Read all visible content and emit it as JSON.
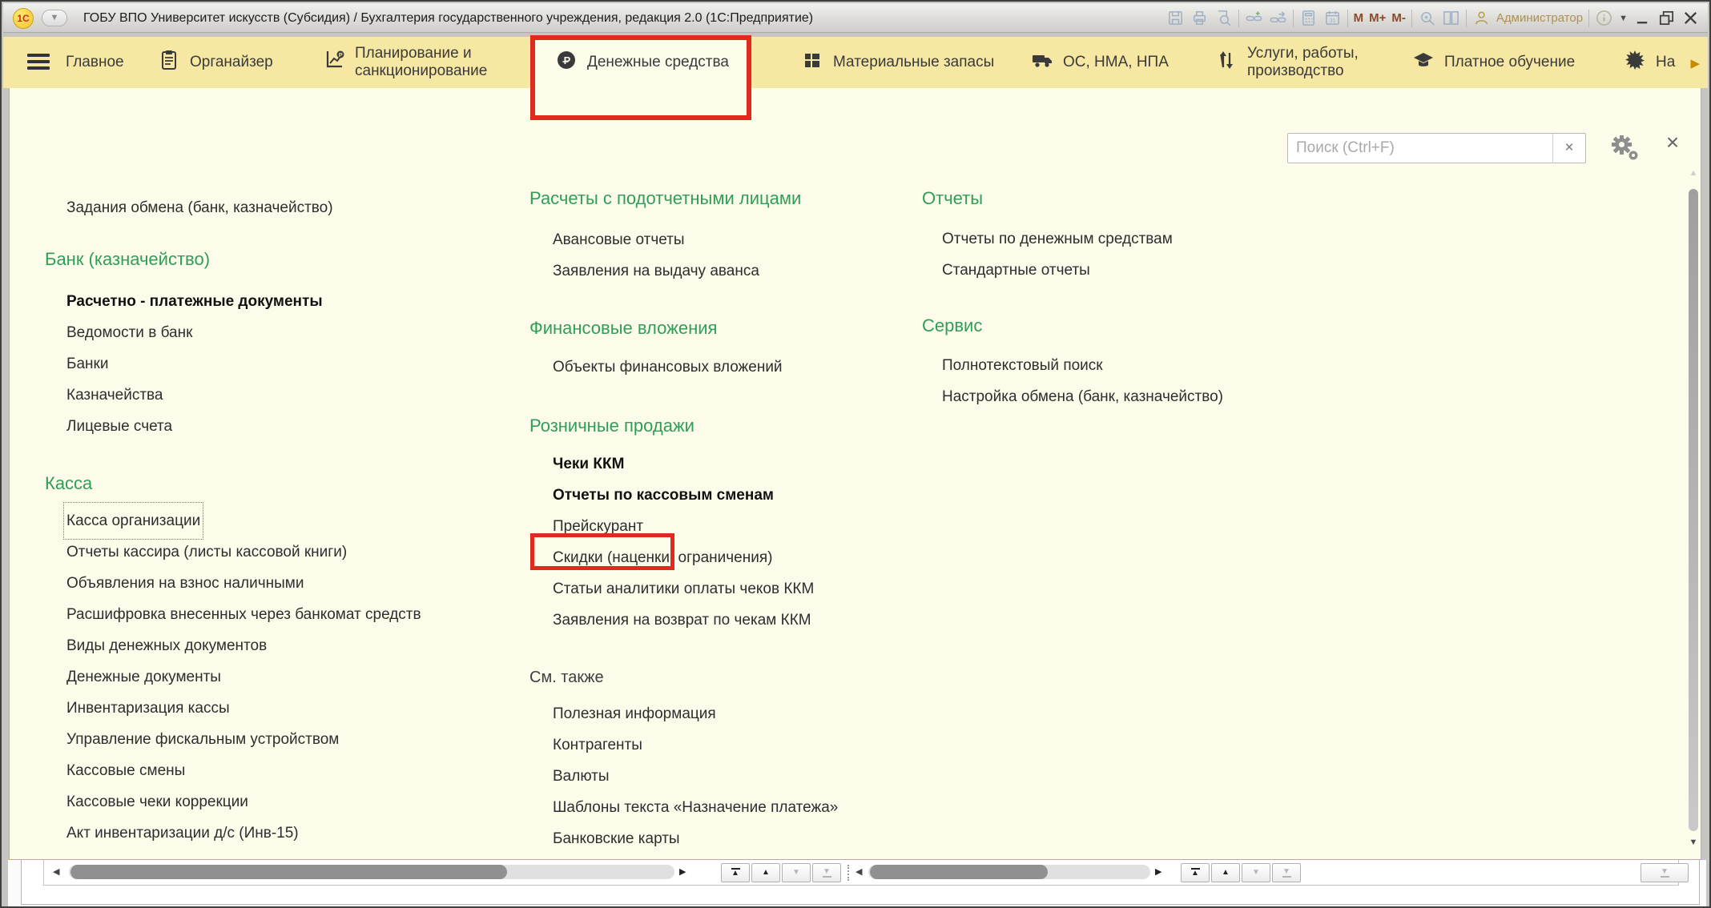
{
  "colors": {
    "accent_green": "#2f9e57",
    "tab_yellow": "#f6e7a3",
    "panel_bg": "#fdfceb",
    "annotation_red": "#e02a1e"
  },
  "titlebar": {
    "title": "ГОБУ ВПО Университет искусств (Субсидия) / Бухгалтерия государственного учреждения, редакция 2.0  (1С:Предприятие)",
    "memory": [
      "М",
      "М+",
      "М-"
    ],
    "user": "Администратор"
  },
  "tabs": [
    {
      "label": "Главное"
    },
    {
      "label": "Органайзер"
    },
    {
      "label": "Планирование и\nсанкционирование"
    },
    {
      "label": "Денежные средства",
      "active": true
    },
    {
      "label": "Материальные запасы"
    },
    {
      "label": "ОС, НМА, НПА"
    },
    {
      "label": "Услуги, работы,\nпроизводство"
    },
    {
      "label": "Платное обучение"
    },
    {
      "label": "На"
    }
  ],
  "search": {
    "placeholder": "Поиск (Ctrl+F)"
  },
  "menu": {
    "exchange_tasks": [
      {
        "label": "Задания обмена (банк, казначейство)"
      }
    ],
    "bank": {
      "header": "Банк (казначейство)",
      "items": [
        {
          "label": "Расчетно - платежные документы",
          "class": "bold"
        },
        {
          "label": "Ведомости в банк"
        },
        {
          "label": "Банки"
        },
        {
          "label": "Казначейства"
        },
        {
          "label": "Лицевые счета"
        }
      ]
    },
    "kassa": {
      "header": "Касса",
      "items": [
        {
          "label": "Касса организации",
          "class": "focused"
        },
        {
          "label": "Отчеты кассира (листы кассовой книги)"
        },
        {
          "label": "Объявления на взнос наличными"
        },
        {
          "label": "Расшифровка внесенных через банкомат средств"
        },
        {
          "label": "Виды денежных документов"
        },
        {
          "label": "Денежные документы"
        },
        {
          "label": "Инвентаризация кассы"
        },
        {
          "label": "Управление фискальным устройством"
        },
        {
          "label": "Кассовые смены"
        },
        {
          "label": "Кассовые чеки коррекции"
        },
        {
          "label": "Акт инвентаризации д/с (Инв-15)"
        }
      ]
    },
    "accountable": {
      "header": "Расчеты с подотчетными лицами",
      "items": [
        {
          "label": "Авансовые отчеты"
        },
        {
          "label": "Заявления на выдачу аванса"
        }
      ]
    },
    "investments": {
      "header": "Финансовые вложения",
      "items": [
        {
          "label": "Объекты финансовых вложений"
        }
      ]
    },
    "retail": {
      "header": "Розничные продажи",
      "items": [
        {
          "label": "Чеки ККМ",
          "class": "bold"
        },
        {
          "label": "Отчеты по кассовым сменам",
          "class": "bold"
        },
        {
          "label": "Прейскурант"
        },
        {
          "label": "Скидки (наценки, ограничения)"
        },
        {
          "label": "Статьи аналитики оплаты чеков ККМ"
        },
        {
          "label": "Заявления на возврат по чекам ККМ"
        }
      ]
    },
    "see_also": {
      "header": "См. также",
      "items": [
        {
          "label": "Полезная информация"
        },
        {
          "label": "Контрагенты"
        },
        {
          "label": "Валюты"
        },
        {
          "label": "Шаблоны текста «Назначение платежа»"
        },
        {
          "label": "Банковские карты"
        }
      ]
    },
    "reports": {
      "header": "Отчеты",
      "items": [
        {
          "label": "Отчеты по денежным средствам"
        },
        {
          "label": "Стандартные отчеты"
        }
      ]
    },
    "service": {
      "header": "Сервис",
      "items": [
        {
          "label": "Полнотекстовый поиск"
        },
        {
          "label": "Настройка обмена (банк, казначейство)"
        }
      ]
    }
  }
}
